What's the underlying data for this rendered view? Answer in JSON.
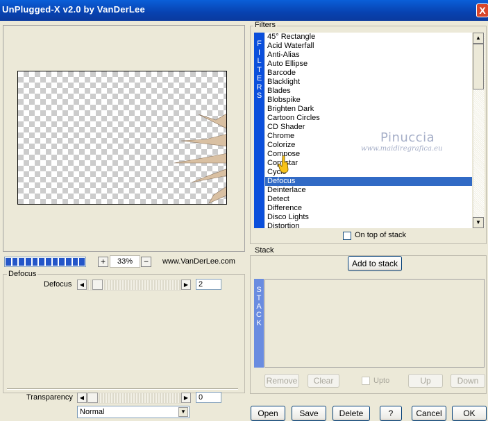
{
  "window": {
    "title": "UnPlugged-X v2.0 by VanDerLee",
    "close": "X"
  },
  "preview": {
    "zoom": "33%",
    "zoom_in": "+",
    "zoom_out": "−",
    "website": "www.VanDerLee.com",
    "progress_fraction": 1.0
  },
  "filters": {
    "group_label": "Filters",
    "strip_letters": [
      "F",
      "I",
      "L",
      "T",
      "E",
      "R",
      "S"
    ],
    "items": [
      "45° Rectangle",
      "Acid Waterfall",
      "Anti-Alias",
      "Auto Ellipse",
      "Barcode",
      "Blacklight",
      "Blades",
      "Blobspike",
      "Brighten Dark",
      "Cartoon Circles",
      "CD Shader",
      "Chrome",
      "Colorize",
      "Compose",
      "Copystar",
      "Cycle",
      "Defocus",
      "Deinterlace",
      "Detect",
      "Difference",
      "Disco Lights",
      "Distortion"
    ],
    "selected": "Defocus",
    "on_top_label": "On top of stack",
    "on_top_checked": false
  },
  "watermark": {
    "name": "Pinuccia",
    "site": "www.maidiregrafica.eu"
  },
  "defocus": {
    "group_label": "Defocus",
    "param_label": "Defocus",
    "param_value": "2",
    "transparency_label": "Transparency",
    "transparency_value": "0",
    "blend_mode": "Normal"
  },
  "stack": {
    "group_label": "Stack",
    "add_label": "Add to stack",
    "strip_letters": [
      "S",
      "T",
      "A",
      "C",
      "K"
    ],
    "remove_label": "Remove",
    "clear_label": "Clear",
    "upto_label": "Upto",
    "up_label": "Up",
    "down_label": "Down"
  },
  "footer": {
    "open": "Open",
    "save": "Save",
    "delete": "Delete",
    "help": "?",
    "cancel": "Cancel",
    "ok": "OK"
  },
  "colors": {
    "title_bar": "#0A5FD8",
    "selection": "#316AC5",
    "filters_strip": "#0B4FDB",
    "stack_strip": "#6A8CE0"
  }
}
